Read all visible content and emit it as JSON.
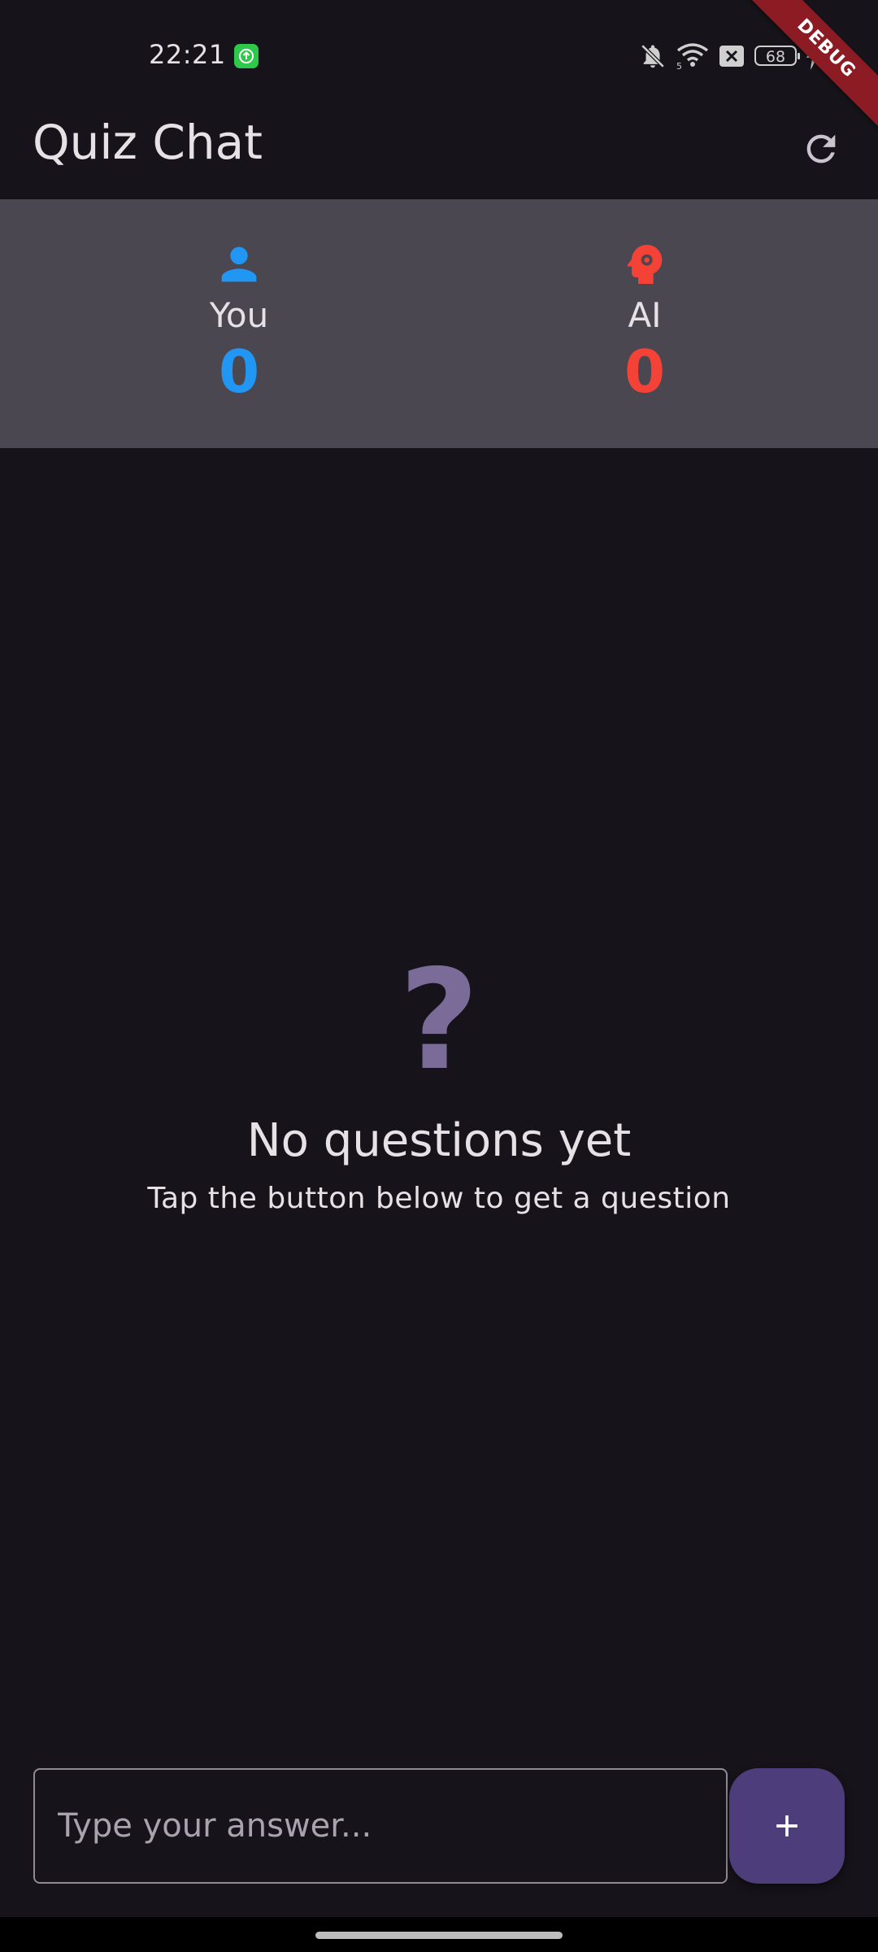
{
  "status_bar": {
    "time": "22:21",
    "battery": "68",
    "icons": [
      "upload-app-icon",
      "bell-off-icon",
      "wifi-icon",
      "sim-off-icon",
      "battery-icon",
      "charging-icon"
    ]
  },
  "debug_banner": "DEBUG",
  "app_bar": {
    "title": "Quiz Chat",
    "refresh_icon": "refresh-icon"
  },
  "scores": {
    "you": {
      "label": "You",
      "value": "0",
      "icon": "person-icon",
      "color": "#2196f3"
    },
    "ai": {
      "label": "AI",
      "value": "0",
      "icon": "psychology-icon",
      "color": "#f44336"
    }
  },
  "empty_state": {
    "icon_glyph": "?",
    "title": "No questions yet",
    "subtitle": "Tap the button below to get a question"
  },
  "input": {
    "placeholder": "Type your answer...",
    "value": ""
  },
  "add_button": {
    "icon": "add-icon"
  },
  "colors": {
    "background": "#16141a",
    "score_panel": "#4a4750",
    "accent": "#4d3d7a",
    "question_mark": "#7b6b98"
  }
}
